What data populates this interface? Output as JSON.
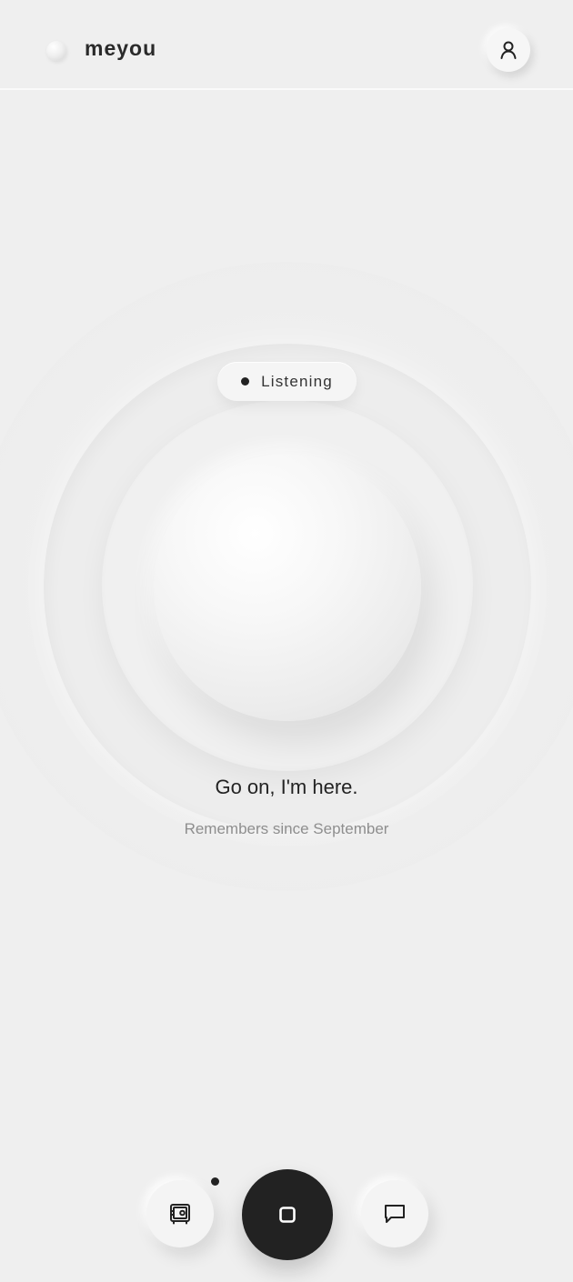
{
  "header": {
    "brand": "meyou",
    "profile_icon": "user-icon"
  },
  "status": {
    "label": "Listening"
  },
  "main": {
    "prompt": "Go on, I'm here.",
    "memory_note": "Remembers since September"
  },
  "controls": {
    "left_icon": "vault-icon",
    "center_icon": "stop-icon",
    "right_icon": "chat-bubble-icon"
  },
  "colors": {
    "background": "#efefef",
    "accent_dark": "#222222"
  }
}
